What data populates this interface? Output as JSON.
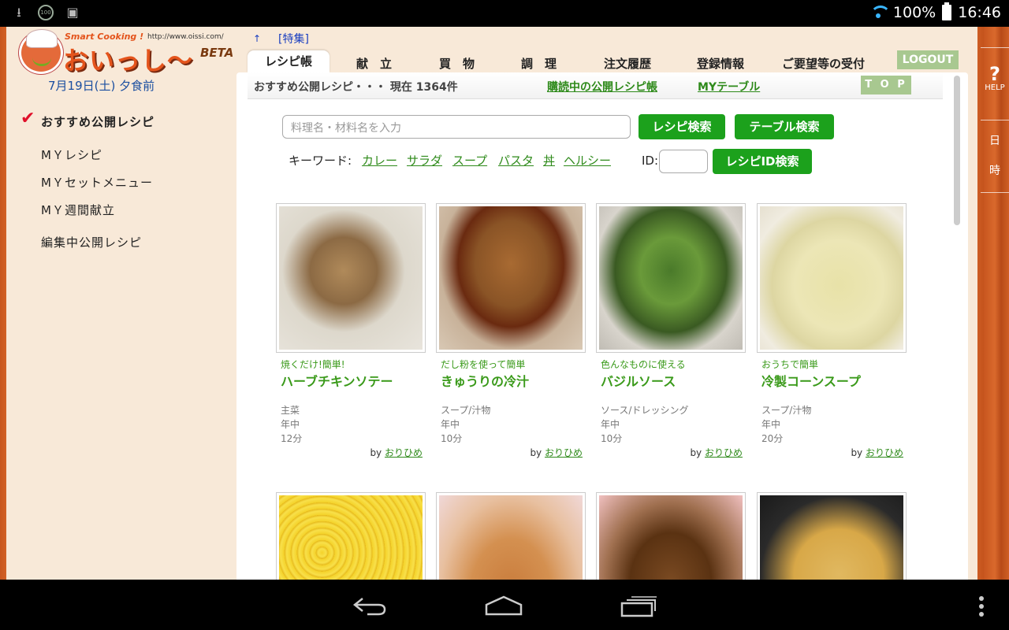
{
  "status_bar": {
    "battery": "100%",
    "time": "16:46"
  },
  "logo": {
    "tagline": "Smart Cooking !",
    "url": "http://www.oissi.com/",
    "name": "おいっし〜",
    "badge": "BETA"
  },
  "date_label": "7月19日(土) 夕食前",
  "sidebar": {
    "items": [
      {
        "label": "おすすめ公開レシピ"
      },
      {
        "label": "MＹレシピ"
      },
      {
        "label": "MＹセットメニュー"
      },
      {
        "label": "MＹ週間献立"
      },
      {
        "label": "編集中公開レシピ"
      }
    ]
  },
  "top_links": {
    "up": "↑",
    "feature": "[特集]"
  },
  "tabs": [
    {
      "label": "レシピ帳"
    },
    {
      "label": "献　立"
    },
    {
      "label": "買　物"
    },
    {
      "label": "調　理"
    },
    {
      "label": "注文履歴"
    },
    {
      "label": "登録情報"
    },
    {
      "label": "ご要望等の受付"
    }
  ],
  "logout_label": "LOGOUT",
  "subbar": {
    "count_text": "おすすめ公開レシピ・・・ 現在 1364件",
    "link_subscribed": "購読中の公開レシピ帳",
    "link_mytable": "MYテーブル",
    "top_label": "T O P"
  },
  "search": {
    "placeholder": "料理名・材料名を入力",
    "recipe_search": "レシピ検索",
    "table_search": "テーブル検索",
    "keyword_label": "キーワード:",
    "keywords": [
      "カレー",
      "サラダ",
      "スープ",
      "パスタ",
      "丼",
      "ヘルシー"
    ],
    "id_label": "ID:",
    "id_search": "レシピID検索"
  },
  "recipes": [
    {
      "sub": "焼くだけ!簡単!",
      "name": "ハーブチキンソテー",
      "category": "主菜",
      "age": "年中",
      "time": "12分",
      "by_label": "by",
      "author": "おりひめ"
    },
    {
      "sub": "だし粉を使って簡単",
      "name": "きゅうりの冷汁",
      "category": "スープ/汁物",
      "age": "年中",
      "time": "10分",
      "by_label": "by",
      "author": "おりひめ"
    },
    {
      "sub": "色んなものに使える",
      "name": "バジルソース",
      "category": "ソース/ドレッシング",
      "age": "年中",
      "time": "10分",
      "by_label": "by",
      "author": "おりひめ"
    },
    {
      "sub": "おうちで簡単",
      "name": "冷製コーンスープ",
      "category": "スープ/汁物",
      "age": "年中",
      "time": "20分",
      "by_label": "by",
      "author": "おりひめ"
    }
  ],
  "right_menu": {
    "help": "HELP",
    "char1": "日",
    "char2": "時"
  }
}
